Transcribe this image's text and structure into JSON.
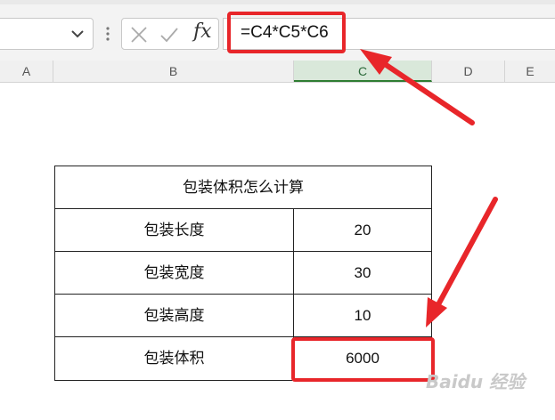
{
  "formula_bar": {
    "name_box_value": "",
    "fx_label": "fx",
    "formula": "=C4*C5*C6"
  },
  "columns": [
    "A",
    "B",
    "C",
    "D",
    "E"
  ],
  "active_column": "C",
  "table": {
    "title": "包装体积怎么计算",
    "rows": [
      {
        "label": "包装长度",
        "value": "20"
      },
      {
        "label": "包装宽度",
        "value": "30"
      },
      {
        "label": "包装高度",
        "value": "10"
      },
      {
        "label": "包装体积",
        "value": "6000"
      }
    ]
  },
  "highlight_color": "#e8262a",
  "watermark": "Baidu 经验"
}
